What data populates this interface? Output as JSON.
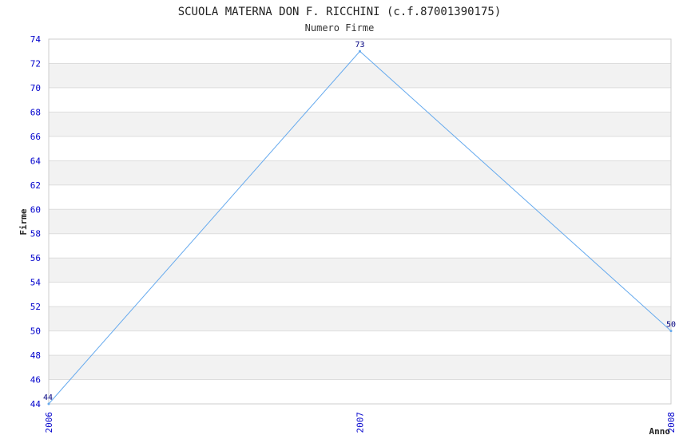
{
  "chart_data": {
    "type": "line",
    "title": "SCUOLA MATERNA DON F. RICCHINI (c.f.87001390175)",
    "subtitle": "Numero Firme",
    "xlabel": "Anno",
    "ylabel": "Firme",
    "categories": [
      "2006",
      "2007",
      "2008"
    ],
    "series": [
      {
        "values": [
          44,
          73,
          50
        ]
      }
    ],
    "data_labels": [
      "44",
      "73",
      "50"
    ],
    "ylim": [
      44,
      74
    ],
    "yticks": [
      44,
      46,
      48,
      50,
      52,
      54,
      56,
      58,
      60,
      62,
      64,
      66,
      68,
      70,
      72,
      74
    ],
    "grid": true,
    "colors": {
      "line": "#66aaee",
      "band": "#f2f2f2",
      "grid": "#dddddd",
      "tick_text": "#0000cc",
      "data_label": "#000080"
    }
  }
}
